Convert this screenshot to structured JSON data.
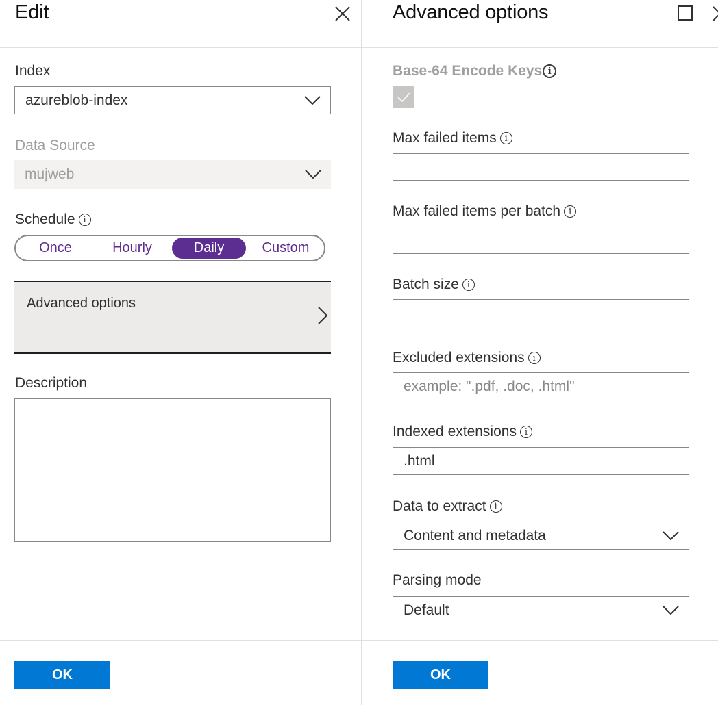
{
  "left": {
    "title": "Edit",
    "index": {
      "label": "Index",
      "value": "azureblob-index"
    },
    "data_source": {
      "label": "Data Source",
      "value": "mujweb"
    },
    "schedule": {
      "label": "Schedule",
      "options": [
        "Once",
        "Hourly",
        "Daily",
        "Custom"
      ],
      "selected": "Daily"
    },
    "advanced_options": {
      "label": "Advanced options"
    },
    "description": {
      "label": "Description",
      "value": ""
    },
    "ok_label": "OK"
  },
  "right": {
    "title": "Advanced options",
    "base64": {
      "label": "Base-64 Encode Keys",
      "checked": true,
      "disabled": true
    },
    "max_failed_items": {
      "label": "Max failed items",
      "value": ""
    },
    "max_failed_items_per_batch": {
      "label": "Max failed items per batch",
      "value": ""
    },
    "batch_size": {
      "label": "Batch size",
      "value": ""
    },
    "excluded_extensions": {
      "label": "Excluded extensions",
      "value": "",
      "placeholder": "example: \".pdf, .doc, .html\""
    },
    "indexed_extensions": {
      "label": "Indexed extensions",
      "value": ".html"
    },
    "data_to_extract": {
      "label": "Data to extract",
      "value": "Content and metadata"
    },
    "parsing_mode": {
      "label": "Parsing mode",
      "value": "Default"
    },
    "ok_label": "OK"
  },
  "colors": {
    "primary_button": "#0078d4",
    "schedule_accent": "#5c2e91",
    "disabled_text": "#a19f9d",
    "divider": "#e1dfdd"
  }
}
